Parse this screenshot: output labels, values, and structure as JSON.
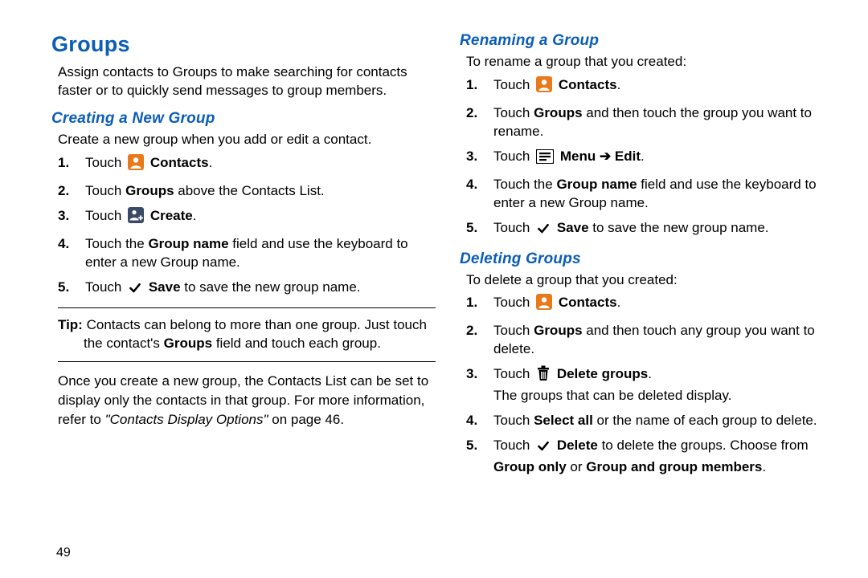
{
  "pageNumber": "49",
  "heading": "Groups",
  "intro": "Assign contacts to Groups to make searching for contacts faster or to quickly send messages to group members.",
  "creating": {
    "title": "Creating a New Group",
    "lead": "Create a new group when you add or edit a contact.",
    "s1_touch": "Touch ",
    "s1_label": "Contacts",
    "s2_a": "Touch ",
    "s2_b": "Groups",
    "s2_c": " above the Contacts List.",
    "s3_touch": "Touch ",
    "s3_label": "Create",
    "s4_a": "Touch the ",
    "s4_b": "Group name",
    "s4_c": " field and use the keyboard to enter a new Group name.",
    "s5_a": "Touch ",
    "s5_b": "Save",
    "s5_c": " to save the new group name."
  },
  "tip": {
    "label": "Tip:",
    "line1": " Contacts can belong to more than one group. Just touch",
    "line2a": "the contact's ",
    "line2b": "Groups",
    "line2c": " field and touch each group."
  },
  "once": {
    "a": "Once you create a new group, the Contacts List can be set to display only the contacts in that group. For more information, refer to ",
    "ref": "\"Contacts Display Options\"",
    "b": " on page 46."
  },
  "renaming": {
    "title": "Renaming a Group",
    "lead": "To rename a group that you created:",
    "s1_touch": "Touch ",
    "s1_label": "Contacts",
    "s2_a": "Touch ",
    "s2_b": "Groups",
    "s2_c": " and then touch the group you want to rename.",
    "s3_touch": "Touch ",
    "s3_menu": "Menu",
    "s3_arrow": " ➔ ",
    "s3_edit": "Edit",
    "s4_a": "Touch the ",
    "s4_b": "Group name",
    "s4_c": " field and use the keyboard to enter a new Group name.",
    "s5_a": "Touch ",
    "s5_b": "Save",
    "s5_c": " to save the new group name."
  },
  "deleting": {
    "title": "Deleting Groups",
    "lead": "To delete a group that you created:",
    "s1_touch": "Touch ",
    "s1_label": "Contacts",
    "s2_a": "Touch ",
    "s2_b": "Groups",
    "s2_c": " and then touch any group you want to delete.",
    "s3_touch": "Touch ",
    "s3_label": "Delete groups",
    "s3_sub": "The groups that can be deleted display.",
    "s4_a": "Touch ",
    "s4_b": "Select all",
    "s4_c": " or the name of each group to delete.",
    "s5_a": "Touch ",
    "s5_b": "Delete",
    "s5_c": " to delete the groups. Choose from ",
    "s5_d": "Group only",
    "s5_e": " or ",
    "s5_f": "Group and group members"
  }
}
